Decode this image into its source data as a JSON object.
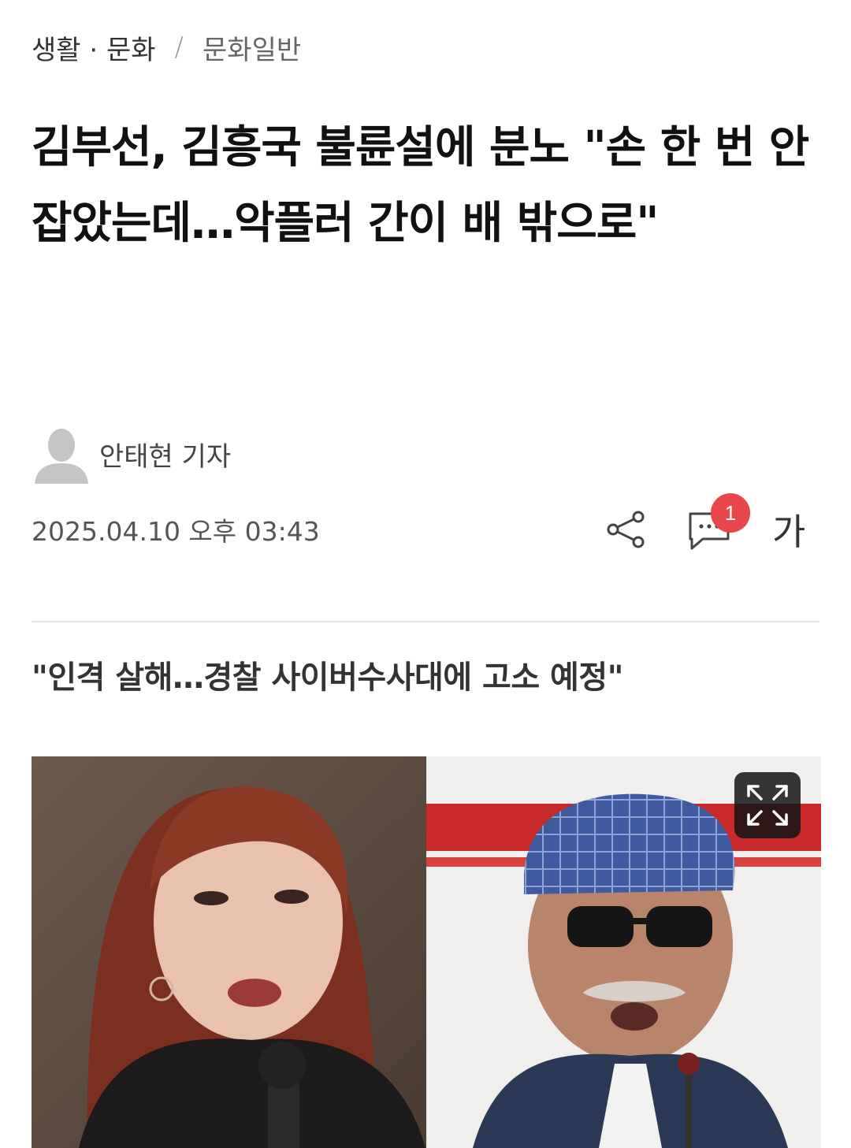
{
  "breadcrumb": {
    "section": "생활 · 문화",
    "separator": "/",
    "subsection": "문화일반"
  },
  "article": {
    "headline": "김부선, 김흥국 불륜설에 분노 \"손 한 번 안잡았는데…악플러 간이 배 밖으로\"",
    "author": "안태현 기자",
    "datetime": "2025.04.10 오후 03:43",
    "subheadline": "\"인격 살해…경찰 사이버수사대에 고소 예정\""
  },
  "toolbar": {
    "share_icon": "share-icon",
    "comment_icon": "comment-icon",
    "comment_count": "1",
    "font_size_label": "가"
  },
  "photo": {
    "expand_icon": "expand-icon"
  },
  "colors": {
    "badge": "#e8464a",
    "text_primary": "#111111",
    "text_secondary": "#555555",
    "divider": "#e4e4e4"
  }
}
